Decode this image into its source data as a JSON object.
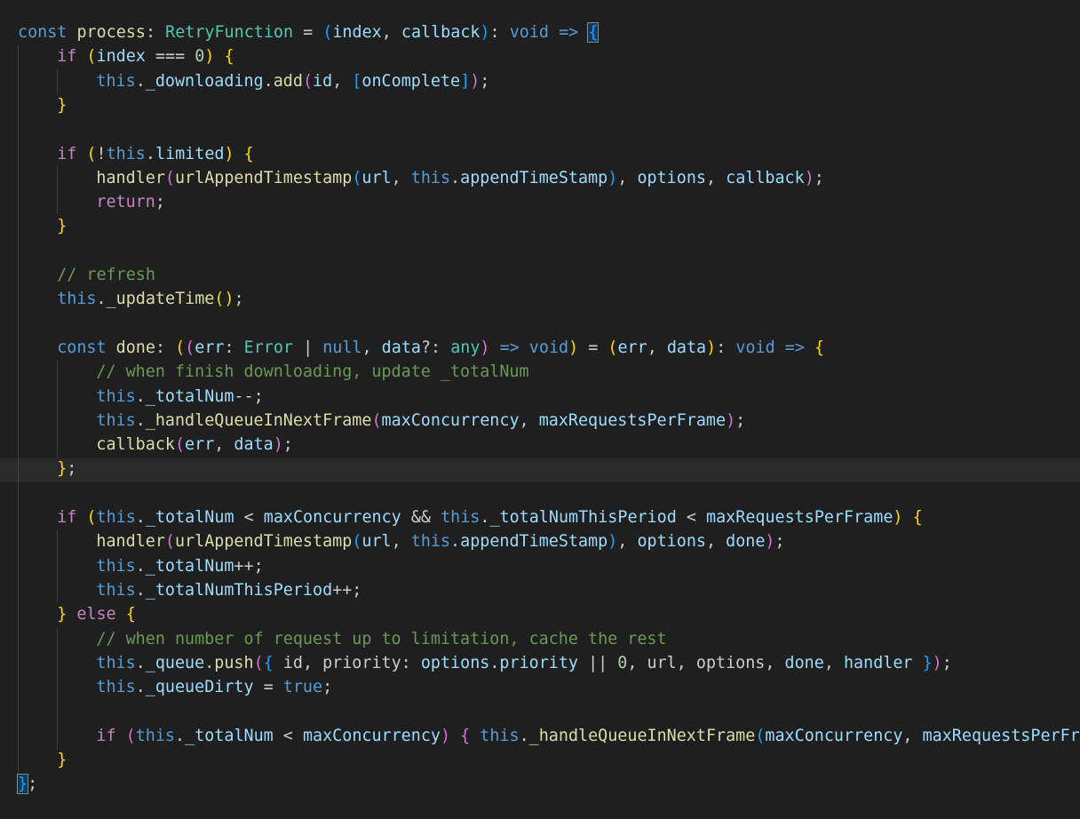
{
  "editor": {
    "language": "typescript",
    "colors": {
      "background": "#1f1f1f",
      "current_line": "#2a2a2a",
      "keyword_control": "#c586c0",
      "keyword": "#569cd6",
      "function": "#dcdcaa",
      "type": "#4ec9b0",
      "variable": "#9cdcfe",
      "number": "#b5cea8",
      "comment": "#6a9955",
      "bracket_1": "#ffd700",
      "bracket_2": "#da70d6",
      "bracket_3": "#179fff"
    },
    "lines": [
      {
        "indent": 0,
        "tokens": [
          [
            "const",
            "kw"
          ],
          [
            " ",
            "punc"
          ],
          [
            "process",
            "fn"
          ],
          [
            ": ",
            "punc"
          ],
          [
            "RetryFunction",
            "type"
          ],
          [
            " = ",
            "punc"
          ],
          [
            "(",
            "b3"
          ],
          [
            "index",
            "var"
          ],
          [
            ", ",
            "punc"
          ],
          [
            "callback",
            "var"
          ],
          [
            ")",
            "b3"
          ],
          [
            ": ",
            "punc"
          ],
          [
            "void",
            "kw"
          ],
          [
            " ",
            "punc"
          ],
          [
            "=>",
            "kw"
          ],
          [
            " ",
            "punc"
          ],
          [
            "{",
            "b3 hl-brace"
          ]
        ]
      },
      {
        "indent": 1,
        "tokens": [
          [
            "if",
            "kw-ctrl"
          ],
          [
            " ",
            "punc"
          ],
          [
            "(",
            "b1"
          ],
          [
            "index",
            "var"
          ],
          [
            " === ",
            "punc"
          ],
          [
            "0",
            "num"
          ],
          [
            ")",
            "b1"
          ],
          [
            " ",
            "punc"
          ],
          [
            "{",
            "b1"
          ]
        ]
      },
      {
        "indent": 2,
        "tokens": [
          [
            "this",
            "kw"
          ],
          [
            ".",
            "punc"
          ],
          [
            "_downloading",
            "var"
          ],
          [
            ".",
            "punc"
          ],
          [
            "add",
            "fn"
          ],
          [
            "(",
            "b2"
          ],
          [
            "id",
            "var"
          ],
          [
            ", ",
            "punc"
          ],
          [
            "[",
            "b3"
          ],
          [
            "onComplete",
            "var"
          ],
          [
            "]",
            "b3"
          ],
          [
            ")",
            "b2"
          ],
          [
            ";",
            "punc"
          ]
        ]
      },
      {
        "indent": 1,
        "tokens": [
          [
            "}",
            "b1"
          ]
        ]
      },
      {
        "indent": 0,
        "tokens": []
      },
      {
        "indent": 1,
        "tokens": [
          [
            "if",
            "kw-ctrl"
          ],
          [
            " ",
            "punc"
          ],
          [
            "(",
            "b1"
          ],
          [
            "!",
            "punc"
          ],
          [
            "this",
            "kw"
          ],
          [
            ".",
            "punc"
          ],
          [
            "limited",
            "var"
          ],
          [
            ")",
            "b1"
          ],
          [
            " ",
            "punc"
          ],
          [
            "{",
            "b1"
          ]
        ]
      },
      {
        "indent": 2,
        "tokens": [
          [
            "handler",
            "fn"
          ],
          [
            "(",
            "b2"
          ],
          [
            "urlAppendTimestamp",
            "fn"
          ],
          [
            "(",
            "b3"
          ],
          [
            "url",
            "var"
          ],
          [
            ", ",
            "punc"
          ],
          [
            "this",
            "kw"
          ],
          [
            ".",
            "punc"
          ],
          [
            "appendTimeStamp",
            "var"
          ],
          [
            ")",
            "b3"
          ],
          [
            ", ",
            "punc"
          ],
          [
            "options",
            "var"
          ],
          [
            ", ",
            "punc"
          ],
          [
            "callback",
            "var"
          ],
          [
            ")",
            "b2"
          ],
          [
            ";",
            "punc"
          ]
        ]
      },
      {
        "indent": 2,
        "tokens": [
          [
            "return",
            "kw-ctrl"
          ],
          [
            ";",
            "punc"
          ]
        ]
      },
      {
        "indent": 1,
        "tokens": [
          [
            "}",
            "b1"
          ]
        ]
      },
      {
        "indent": 0,
        "tokens": []
      },
      {
        "indent": 1,
        "tokens": [
          [
            "// refresh",
            "cmt"
          ]
        ]
      },
      {
        "indent": 1,
        "tokens": [
          [
            "this",
            "kw"
          ],
          [
            ".",
            "punc"
          ],
          [
            "_updateTime",
            "fn"
          ],
          [
            "(",
            "b1"
          ],
          [
            ")",
            "b1"
          ],
          [
            ";",
            "punc"
          ]
        ]
      },
      {
        "indent": 0,
        "tokens": []
      },
      {
        "indent": 1,
        "tokens": [
          [
            "const",
            "kw"
          ],
          [
            " ",
            "punc"
          ],
          [
            "done",
            "fn"
          ],
          [
            ": ",
            "punc"
          ],
          [
            "(",
            "b1"
          ],
          [
            "(",
            "b2"
          ],
          [
            "err",
            "var"
          ],
          [
            ": ",
            "punc"
          ],
          [
            "Error",
            "type"
          ],
          [
            " | ",
            "punc"
          ],
          [
            "null",
            "kw"
          ],
          [
            ", ",
            "punc"
          ],
          [
            "data",
            "var"
          ],
          [
            "?: ",
            "punc"
          ],
          [
            "any",
            "type"
          ],
          [
            ")",
            "b2"
          ],
          [
            " ",
            "punc"
          ],
          [
            "=>",
            "kw"
          ],
          [
            " ",
            "punc"
          ],
          [
            "void",
            "kw"
          ],
          [
            ")",
            "b1"
          ],
          [
            " = ",
            "punc"
          ],
          [
            "(",
            "b1"
          ],
          [
            "err",
            "var"
          ],
          [
            ", ",
            "punc"
          ],
          [
            "data",
            "var"
          ],
          [
            ")",
            "b1"
          ],
          [
            ": ",
            "punc"
          ],
          [
            "void",
            "kw"
          ],
          [
            " ",
            "punc"
          ],
          [
            "=>",
            "kw"
          ],
          [
            " ",
            "punc"
          ],
          [
            "{",
            "b1"
          ]
        ]
      },
      {
        "indent": 2,
        "tokens": [
          [
            "// when finish downloading, update _totalNum",
            "cmt"
          ]
        ]
      },
      {
        "indent": 2,
        "tokens": [
          [
            "this",
            "kw"
          ],
          [
            ".",
            "punc"
          ],
          [
            "_totalNum",
            "var"
          ],
          [
            "--;",
            "punc"
          ]
        ]
      },
      {
        "indent": 2,
        "tokens": [
          [
            "this",
            "kw"
          ],
          [
            ".",
            "punc"
          ],
          [
            "_handleQueueInNextFrame",
            "fn"
          ],
          [
            "(",
            "b2"
          ],
          [
            "maxConcurrency",
            "var"
          ],
          [
            ", ",
            "punc"
          ],
          [
            "maxRequestsPerFrame",
            "var"
          ],
          [
            ")",
            "b2"
          ],
          [
            ";",
            "punc"
          ]
        ]
      },
      {
        "indent": 2,
        "tokens": [
          [
            "callback",
            "fn"
          ],
          [
            "(",
            "b2"
          ],
          [
            "err",
            "var"
          ],
          [
            ", ",
            "punc"
          ],
          [
            "data",
            "var"
          ],
          [
            ")",
            "b2"
          ],
          [
            ";",
            "punc"
          ]
        ]
      },
      {
        "indent": 1,
        "tokens": [
          [
            "}",
            "b1"
          ],
          [
            ";",
            "punc"
          ]
        ]
      },
      {
        "indent": 0,
        "tokens": []
      },
      {
        "indent": 1,
        "tokens": [
          [
            "if",
            "kw-ctrl"
          ],
          [
            " ",
            "punc"
          ],
          [
            "(",
            "b1"
          ],
          [
            "this",
            "kw"
          ],
          [
            ".",
            "punc"
          ],
          [
            "_totalNum",
            "var"
          ],
          [
            " < ",
            "punc"
          ],
          [
            "maxConcurrency",
            "var"
          ],
          [
            " && ",
            "punc"
          ],
          [
            "this",
            "kw"
          ],
          [
            ".",
            "punc"
          ],
          [
            "_totalNumThisPeriod",
            "var"
          ],
          [
            " < ",
            "punc"
          ],
          [
            "maxRequestsPerFrame",
            "var"
          ],
          [
            ")",
            "b1"
          ],
          [
            " ",
            "punc"
          ],
          [
            "{",
            "b1"
          ]
        ]
      },
      {
        "indent": 2,
        "tokens": [
          [
            "handler",
            "fn"
          ],
          [
            "(",
            "b2"
          ],
          [
            "urlAppendTimestamp",
            "fn"
          ],
          [
            "(",
            "b3"
          ],
          [
            "url",
            "var"
          ],
          [
            ", ",
            "punc"
          ],
          [
            "this",
            "kw"
          ],
          [
            ".",
            "punc"
          ],
          [
            "appendTimeStamp",
            "var"
          ],
          [
            ")",
            "b3"
          ],
          [
            ", ",
            "punc"
          ],
          [
            "options",
            "var"
          ],
          [
            ", ",
            "punc"
          ],
          [
            "done",
            "var"
          ],
          [
            ")",
            "b2"
          ],
          [
            ";",
            "punc"
          ]
        ]
      },
      {
        "indent": 2,
        "tokens": [
          [
            "this",
            "kw"
          ],
          [
            ".",
            "punc"
          ],
          [
            "_totalNum",
            "var"
          ],
          [
            "++;",
            "punc"
          ]
        ]
      },
      {
        "indent": 2,
        "tokens": [
          [
            "this",
            "kw"
          ],
          [
            ".",
            "punc"
          ],
          [
            "_totalNumThisPeriod",
            "var"
          ],
          [
            "++;",
            "punc"
          ]
        ]
      },
      {
        "indent": 1,
        "tokens": [
          [
            "}",
            "b1"
          ],
          [
            " ",
            "punc"
          ],
          [
            "else",
            "kw-ctrl"
          ],
          [
            " ",
            "punc"
          ],
          [
            "{",
            "b1"
          ]
        ]
      },
      {
        "indent": 2,
        "tokens": [
          [
            "// when number of request up to limitation, cache the rest",
            "cmt"
          ]
        ]
      },
      {
        "indent": 2,
        "tokens": [
          [
            "this",
            "kw"
          ],
          [
            ".",
            "punc"
          ],
          [
            "_queue",
            "var"
          ],
          [
            ".",
            "punc"
          ],
          [
            "push",
            "fn"
          ],
          [
            "(",
            "b2"
          ],
          [
            "{",
            "b3"
          ],
          [
            " id, priority: ",
            "punc"
          ],
          [
            "options",
            "var"
          ],
          [
            ".",
            "punc"
          ],
          [
            "priority",
            "var"
          ],
          [
            " || ",
            "punc"
          ],
          [
            "0",
            "num"
          ],
          [
            ", url, options, ",
            "punc"
          ],
          [
            "done",
            "var"
          ],
          [
            ", ",
            "punc"
          ],
          [
            "handler",
            "var"
          ],
          [
            " ",
            "punc"
          ],
          [
            "}",
            "b3"
          ],
          [
            ")",
            "b2"
          ],
          [
            ";",
            "punc"
          ]
        ]
      },
      {
        "indent": 2,
        "tokens": [
          [
            "this",
            "kw"
          ],
          [
            ".",
            "punc"
          ],
          [
            "_queueDirty",
            "var"
          ],
          [
            " = ",
            "punc"
          ],
          [
            "true",
            "kw"
          ],
          [
            ";",
            "punc"
          ]
        ]
      },
      {
        "indent": 0,
        "tokens": []
      },
      {
        "indent": 2,
        "tokens": [
          [
            "if",
            "kw-ctrl"
          ],
          [
            " ",
            "punc"
          ],
          [
            "(",
            "b2"
          ],
          [
            "this",
            "kw"
          ],
          [
            ".",
            "punc"
          ],
          [
            "_totalNum",
            "var"
          ],
          [
            " < ",
            "punc"
          ],
          [
            "maxConcurrency",
            "var"
          ],
          [
            ")",
            "b2"
          ],
          [
            " ",
            "punc"
          ],
          [
            "{",
            "b2"
          ],
          [
            " ",
            "punc"
          ],
          [
            "this",
            "kw"
          ],
          [
            ".",
            "punc"
          ],
          [
            "_handleQueueInNextFrame",
            "fn"
          ],
          [
            "(",
            "b3"
          ],
          [
            "maxConcurrency",
            "var"
          ],
          [
            ", ",
            "punc"
          ],
          [
            "maxRequestsPerFrame",
            "var"
          ],
          [
            ")",
            "b3"
          ],
          [
            ";",
            "punc"
          ],
          [
            " ",
            "punc"
          ],
          [
            "}",
            "b2"
          ]
        ]
      },
      {
        "indent": 1,
        "tokens": [
          [
            "}",
            "b1"
          ]
        ]
      },
      {
        "indent": 0,
        "tokens": [
          [
            "}",
            "b3 hl-brace"
          ],
          [
            ";",
            "punc"
          ]
        ]
      }
    ]
  }
}
